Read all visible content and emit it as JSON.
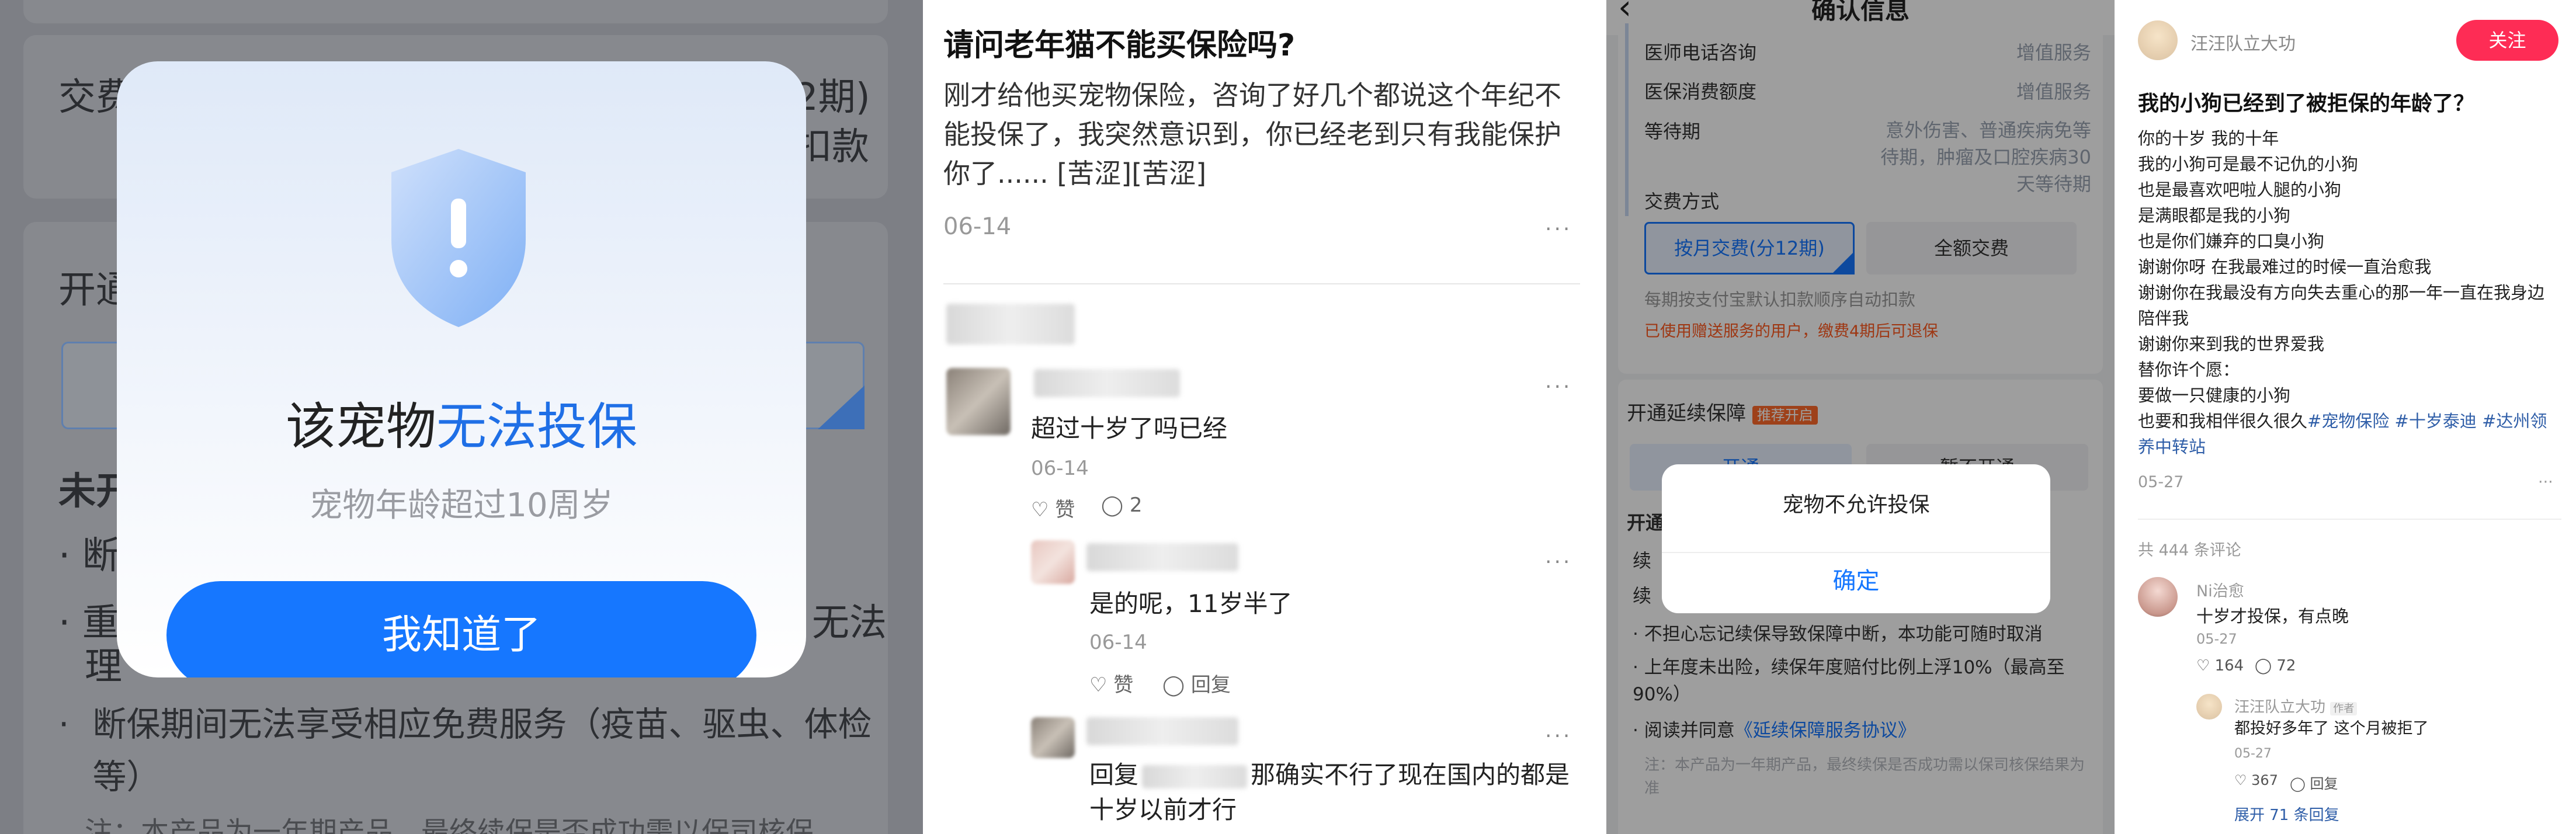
{
  "panel1": {
    "bg_fragments": [
      "交费",
      "2期)",
      "扣款",
      "开通",
      "未开",
      "断",
      "重",
      "无法",
      "理",
      "断保期间无法享受相应免费服务（疫苗、驱虫、体检等）",
      "注：本产品为一年期产品，最终续保是否成功需以保司核保"
    ],
    "bullet": "·",
    "dialog": {
      "icon": "shield-alert-icon",
      "title_prefix": "该宠物",
      "title_highlight": "无法投保",
      "subtitle": "宠物年龄超过10周岁",
      "button": "我知道了"
    }
  },
  "panel2": {
    "title": "请问老年猫不能买保险吗?",
    "body": "刚才给他买宠物保险，咨询了好几个都说这个年纪不能投保了，我突然意识到，你已经老到只有我能保护你了...... [苦涩][苦涩]",
    "date": "06-14",
    "more": "···",
    "comments": [
      {
        "text": "超过十岁了吗已经",
        "date": "06-14",
        "like": "赞",
        "reply_count": "2"
      },
      {
        "text": "是的呢，11岁半了",
        "date": "06-14",
        "like": "赞",
        "reply": "回复"
      },
      {
        "prefix": "回复",
        "text": "那确实不行了现在国内的都是十岁以前才行"
      }
    ]
  },
  "panel3": {
    "title": "确认信息",
    "rows": [
      {
        "label": "医师电话咨询",
        "value": "增值服务"
      },
      {
        "label": "医保消费额度",
        "value": "增值服务"
      },
      {
        "label": "等待期",
        "value": "意外伤害、普通疾病免等待期，肿瘤及口腔疾病30天等待期"
      }
    ],
    "pay_label": "交费方式",
    "pay_option1": "按月交费(分12期)",
    "pay_option2": "全额交费",
    "pay_note": "每期按支付宝默认扣款顺序自动扣款",
    "pay_warn": "已使用赠送服务的用户，缴费4期后可退保",
    "renew_title": "开通延续保障",
    "renew_badge": "推荐开启",
    "renew_opt1": "开通",
    "renew_opt2": "暂不开通",
    "section2_title": "开通",
    "bullets": [
      "续",
      "续",
      "不担心忘记续保导致保障中断，本功能可随时取消",
      "上年度未出险，续保年度赔付比例上浮10%（最高至90%）",
      "阅读并同意"
    ],
    "agreement": "《延续保障服务协议》",
    "footnote": "注：本产品为一年期产品，最终续保是否成功需以保司核保结果为准",
    "dialog_text": "宠物不允许投保",
    "dialog_button": "确定",
    "colors": {
      "accent": "#1677ff",
      "warn": "#ff5a1f"
    }
  },
  "panel4": {
    "author": "汪汪队立大功",
    "follow": "关注",
    "title": "我的小狗已经到了被拒保的年龄了？",
    "lines": [
      "你的十岁 我的十年",
      "我的小狗可是最不记仇的小狗",
      "也是最喜欢吧啦人腿的小狗",
      "是满眼都是我的小狗",
      "也是你们嫌弃的口臭小狗",
      "谢谢你呀 在我最难过的时候一直治愈我",
      "谢谢你在我最没有方向失去重心的那一年一直在我身边陪伴我",
      "谢谢你来到我的世界爱我",
      "替你许个愿：",
      "要做一只健康的小狗",
      "也要和我相伴很久很久"
    ],
    "tags": [
      "#宠物保险",
      " #十岁泰迪",
      " #达州领养中转站"
    ],
    "post_date": "05-27",
    "more": "···",
    "comment_count": "共 444 条评论",
    "comment1": {
      "user": "Ni治愈",
      "text": "十岁才投保，有点晚",
      "date": "05-27",
      "likes": "164",
      "replies": "72"
    },
    "comment2": {
      "user": "汪汪队立大功",
      "badge": "作者",
      "text": "都投好多年了 这个月被拒了",
      "date": "05-27",
      "likes": "367",
      "reply": "回复"
    },
    "expand": "展开 71 条回复"
  }
}
